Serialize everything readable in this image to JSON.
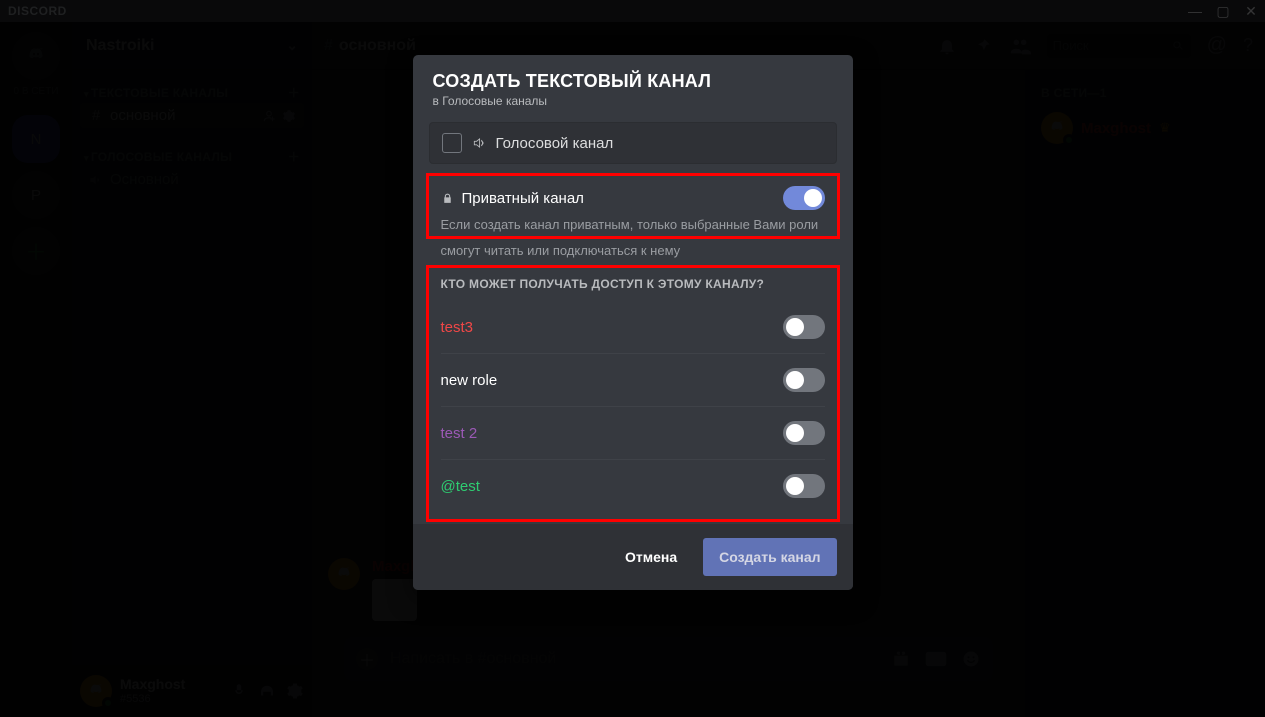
{
  "brand": "DISCORD",
  "window": {
    "min": "—",
    "max": "▢",
    "close": "✕"
  },
  "guilds": {
    "home_icon": "discord",
    "online_label": "0 В СЕТИ",
    "items": [
      "N",
      "P"
    ]
  },
  "server": {
    "name": "Nastroiki",
    "categories": [
      {
        "label": "ТЕКСТОВЫЕ КАНАЛЫ",
        "channels": [
          {
            "name": "основной",
            "type": "text",
            "selected": true
          }
        ]
      },
      {
        "label": "ГОЛОСОВЫЕ КАНАЛЫ",
        "channels": [
          {
            "name": "Основной",
            "type": "voice",
            "selected": false
          }
        ]
      }
    ]
  },
  "user_panel": {
    "name": "Maxghost",
    "disc": "#5536"
  },
  "header": {
    "channel": "основной",
    "search_placeholder": "Поиск"
  },
  "message": {
    "author": "Maxghost",
    "time": "Сегодня, в 13:54"
  },
  "composer": {
    "placeholder": "Написать в #основной"
  },
  "members": {
    "section": "В СЕТИ—1",
    "user": "Maxghost"
  },
  "modal": {
    "title": "СОЗДАТЬ ТЕКСТОВЫЙ КАНАЛ",
    "subtitle": "в Голосовые каналы",
    "voice_type_label": "Голосовой канал",
    "private_label": "Приватный канал",
    "private_on": true,
    "private_desc_line1": "Если создать канал приватным, только выбранные Вами роли",
    "private_desc_line2": "смогут читать или подключаться к нему",
    "access_question": "КТО МОЖЕТ ПОЛУЧАТЬ ДОСТУП К ЭТОМУ КАНАЛУ?",
    "roles": [
      {
        "name": "test3",
        "color": "#f04747",
        "on": false
      },
      {
        "name": "new role",
        "color": "#ffffff",
        "on": false
      },
      {
        "name": "test 2",
        "color": "#9b59b6",
        "on": false
      },
      {
        "name": "@test",
        "color": "#2ecc71",
        "on": false
      }
    ],
    "cancel": "Отмена",
    "create": "Создать канал"
  }
}
